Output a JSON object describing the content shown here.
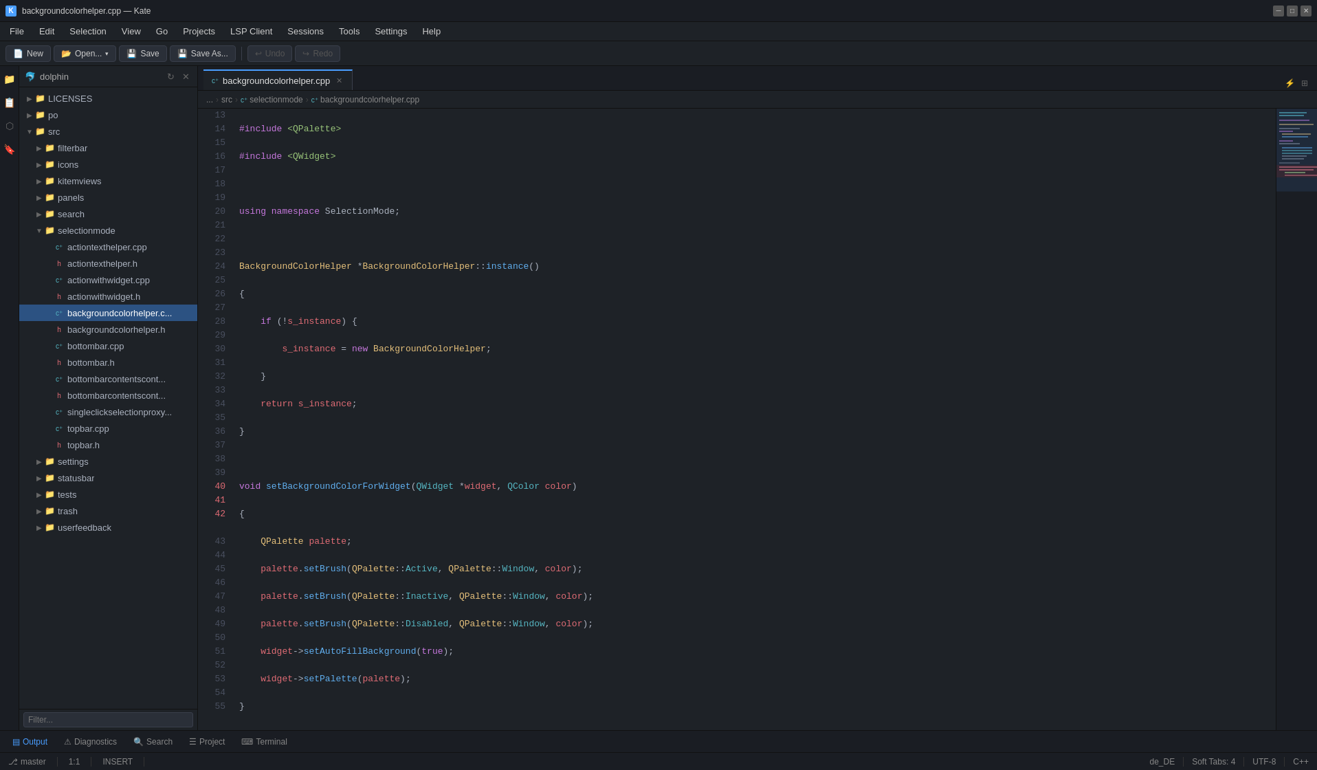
{
  "titlebar": {
    "title": "backgroundcolorhelper.cpp — Kate",
    "icon": "K"
  },
  "menubar": {
    "items": [
      "File",
      "Edit",
      "Selection",
      "View",
      "Go",
      "Projects",
      "LSP Client",
      "Sessions",
      "Tools",
      "Settings",
      "Help"
    ]
  },
  "toolbar": {
    "new_label": "New",
    "open_label": "Open...",
    "save_label": "Save",
    "save_as_label": "Save As...",
    "undo_label": "Undo",
    "redo_label": "Redo"
  },
  "filetree": {
    "title": "dolphin",
    "filter_placeholder": "Filter...",
    "items": [
      {
        "id": "licenses",
        "name": "LICENSES",
        "type": "folder",
        "depth": 0,
        "expanded": false
      },
      {
        "id": "po",
        "name": "po",
        "type": "folder",
        "depth": 0,
        "expanded": false
      },
      {
        "id": "src",
        "name": "src",
        "type": "folder",
        "depth": 0,
        "expanded": true
      },
      {
        "id": "filterbar",
        "name": "filterbar",
        "type": "folder",
        "depth": 1,
        "expanded": false
      },
      {
        "id": "icons",
        "name": "icons",
        "type": "folder",
        "depth": 1,
        "expanded": false
      },
      {
        "id": "kitemviews",
        "name": "kitemviews",
        "type": "folder",
        "depth": 1,
        "expanded": false
      },
      {
        "id": "panels",
        "name": "panels",
        "type": "folder",
        "depth": 1,
        "expanded": false
      },
      {
        "id": "search",
        "name": "search",
        "type": "folder",
        "depth": 1,
        "expanded": false
      },
      {
        "id": "selectionmode",
        "name": "selectionmode",
        "type": "folder",
        "depth": 1,
        "expanded": true
      },
      {
        "id": "actiontexthelper.cpp",
        "name": "actiontexthelper.cpp",
        "type": "cpp",
        "depth": 2,
        "expanded": false
      },
      {
        "id": "actiontexthelper.h",
        "name": "actiontexthelper.h",
        "type": "h",
        "depth": 2,
        "expanded": false
      },
      {
        "id": "actionwithwidget.cpp",
        "name": "actionwithwidget.cpp",
        "type": "cpp",
        "depth": 2,
        "expanded": false
      },
      {
        "id": "actionwithwidget.h",
        "name": "actionwithwidget.h",
        "type": "h",
        "depth": 2,
        "expanded": false
      },
      {
        "id": "backgroundcolorhelper.cpp",
        "name": "backgroundcolorhelper.c...",
        "type": "cpp",
        "depth": 2,
        "expanded": false,
        "selected": true
      },
      {
        "id": "backgroundcolorhelper.h",
        "name": "backgroundcolorhelper.h",
        "type": "h",
        "depth": 2,
        "expanded": false
      },
      {
        "id": "bottombar.cpp",
        "name": "bottombar.cpp",
        "type": "cpp",
        "depth": 2,
        "expanded": false
      },
      {
        "id": "bottombar.h",
        "name": "bottombar.h",
        "type": "h",
        "depth": 2,
        "expanded": false
      },
      {
        "id": "bottombarcontentscont1",
        "name": "bottombarcontentscont...",
        "type": "cpp",
        "depth": 2,
        "expanded": false
      },
      {
        "id": "bottombarcontentscont2",
        "name": "bottombarcontentscont...",
        "type": "h",
        "depth": 2,
        "expanded": false
      },
      {
        "id": "singleclickselectionproxy",
        "name": "singleclickselectionproxy...",
        "type": "cpp",
        "depth": 2,
        "expanded": false
      },
      {
        "id": "topbar.cpp",
        "name": "topbar.cpp",
        "type": "cpp",
        "depth": 2,
        "expanded": false
      },
      {
        "id": "topbar.h",
        "name": "topbar.h",
        "type": "h",
        "depth": 2,
        "expanded": false
      },
      {
        "id": "settings",
        "name": "settings",
        "type": "folder",
        "depth": 1,
        "expanded": false
      },
      {
        "id": "statusbar",
        "name": "statusbar",
        "type": "folder",
        "depth": 1,
        "expanded": false
      },
      {
        "id": "tests",
        "name": "tests",
        "type": "folder",
        "depth": 1,
        "expanded": false
      },
      {
        "id": "trash",
        "name": "trash",
        "type": "folder",
        "depth": 1,
        "expanded": false
      },
      {
        "id": "userfeedback",
        "name": "userfeedback",
        "type": "folder",
        "depth": 1,
        "expanded": false
      }
    ]
  },
  "editor": {
    "tab_label": "backgroundcolorhelper.cpp",
    "breadcrumb": {
      "parts": [
        "...",
        "src",
        "selectionmode",
        "backgroundcolorhelper.cpp"
      ]
    },
    "first_line": 13
  },
  "statusbar": {
    "output_label": "Output",
    "diagnostics_label": "Diagnostics",
    "search_label": "Search",
    "project_label": "Project",
    "terminal_label": "Terminal",
    "branch": "master",
    "position": "1:1",
    "mode": "INSERT",
    "locale": "de_DE",
    "indent": "Soft Tabs: 4",
    "encoding": "UTF-8",
    "language": "C++"
  }
}
